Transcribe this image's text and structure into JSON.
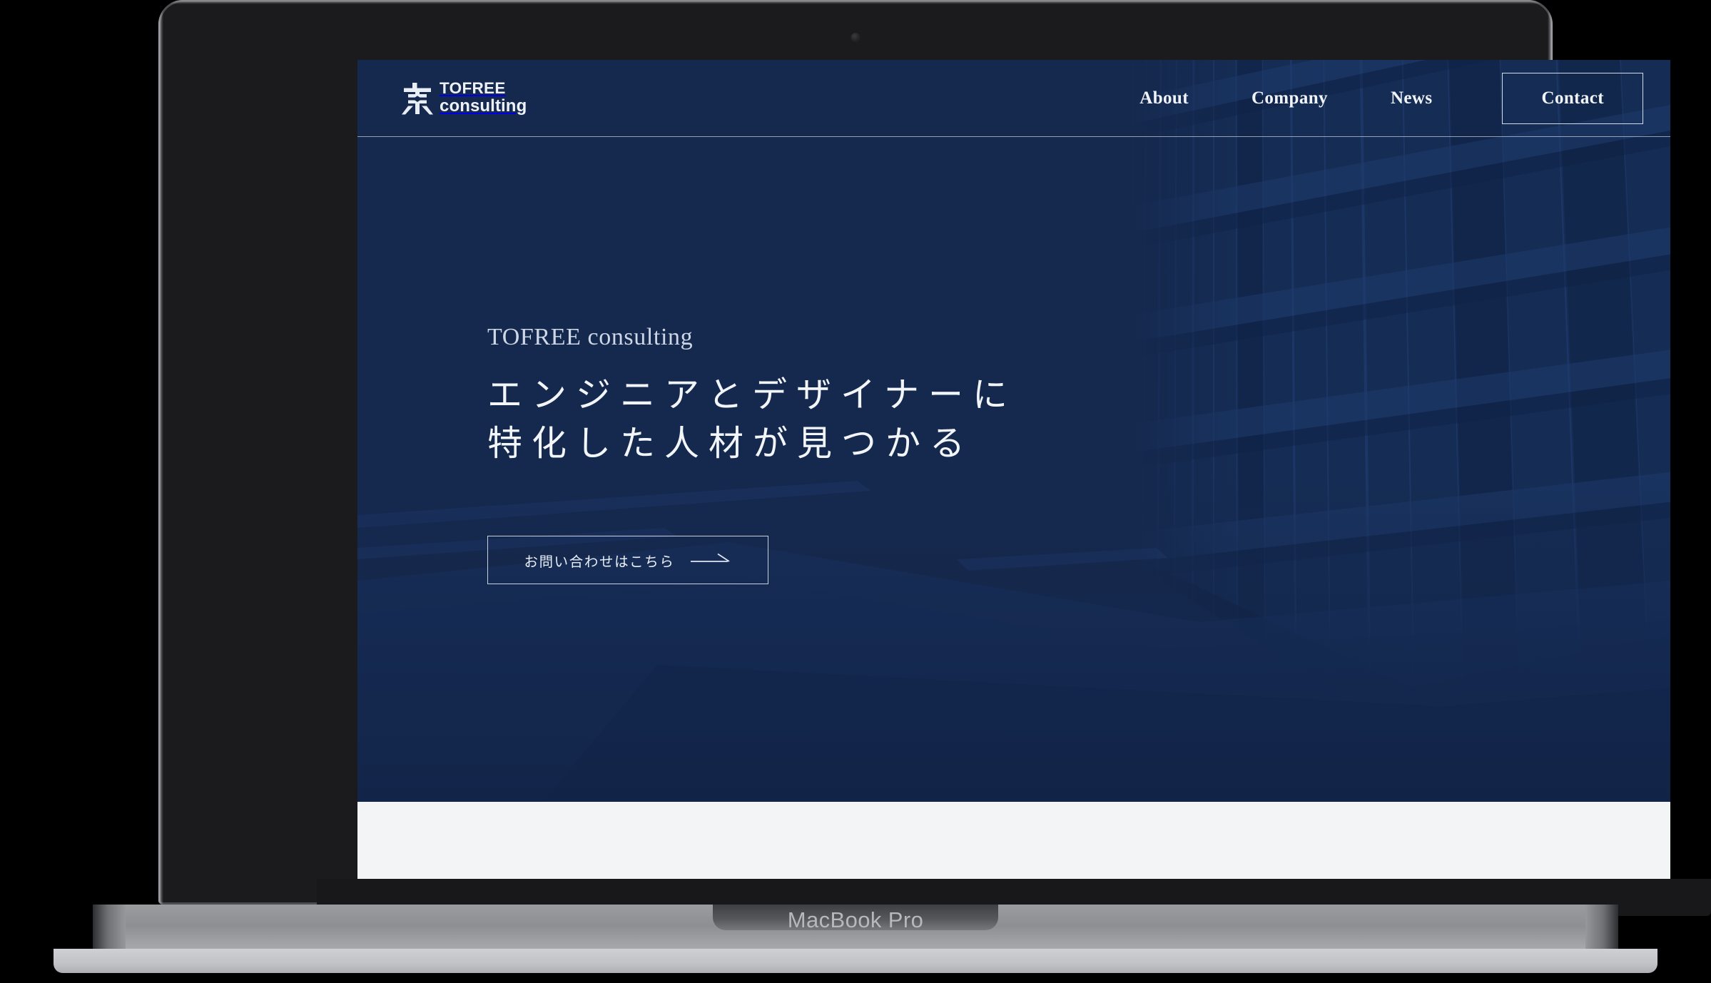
{
  "device": {
    "name": "MacBook Pro",
    "camera_icon": "camera-dot"
  },
  "site": {
    "brand": {
      "mark_icon": "tofree-higashi-logo-icon",
      "name_line1": "TOFREE",
      "name_line2": "consulting"
    },
    "nav": {
      "items": [
        {
          "label": "About"
        },
        {
          "label": "Company"
        },
        {
          "label": "News"
        }
      ],
      "cta": {
        "label": "Contact"
      }
    },
    "hero": {
      "eyebrow": "TOFREE consulting",
      "title_line1": "エンジニアとデザイナーに",
      "title_line2": "特化した人材が見つかる",
      "cta": {
        "label": "お問い合わせはこちら",
        "arrow_icon": "long-arrow-right-icon"
      },
      "background_art": "glass-office-building-facade"
    }
  },
  "colors": {
    "navy": "#15284d",
    "navy_deep": "#122344",
    "text_light": "#f2f6fb",
    "text_muted": "#cdd7e6",
    "section_light": "#f2f4f6",
    "bezel": "#1b1b1d",
    "base_silver": "#9b9ca0"
  }
}
